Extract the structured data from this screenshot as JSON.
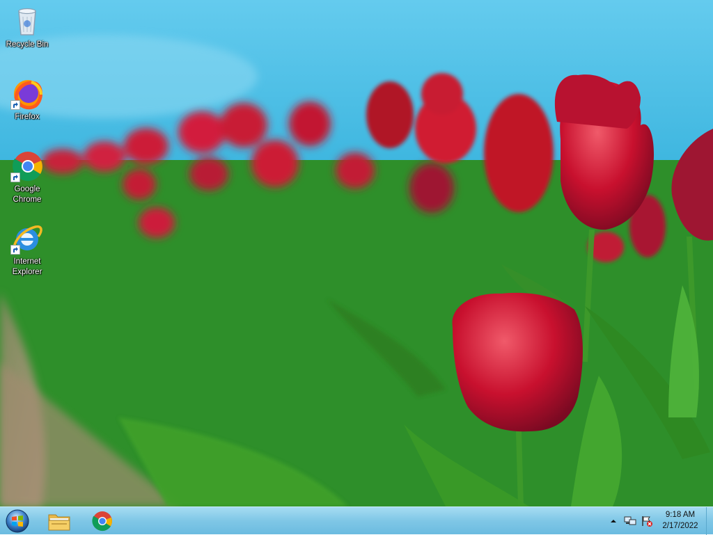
{
  "desktop": {
    "icons": [
      {
        "label": "Recycle Bin",
        "icon": "recycle-bin-icon"
      },
      {
        "label": "Firefox",
        "icon": "firefox-icon"
      },
      {
        "label": "Google\nChrome",
        "icon": "chrome-icon"
      },
      {
        "label": "Internet\nExplorer",
        "icon": "internet-explorer-icon"
      }
    ]
  },
  "taskbar": {
    "start_icon": "windows-start-orb-icon",
    "pinned": [
      {
        "name": "File Explorer",
        "icon": "folder-icon"
      },
      {
        "name": "Google Chrome",
        "icon": "chrome-icon"
      }
    ],
    "tray": {
      "show_hidden_icon": "up-arrow-icon",
      "network_icon": "network-icon",
      "action_center_icon": "flag-icon"
    },
    "clock": {
      "time": "9:18 AM",
      "date": "2/17/2022"
    }
  },
  "colors": {
    "sky": "#4cc0e8",
    "grass": "#2c8d2a",
    "tulip": "#c8102e",
    "taskbar": "#7fc7e6"
  }
}
